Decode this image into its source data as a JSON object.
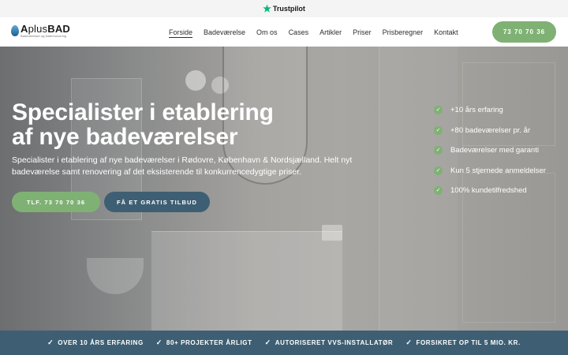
{
  "topbar": {
    "trustpilot_label": "Trustpilot",
    "star_icon": "star-icon"
  },
  "logo": {
    "brand_prefix": "A",
    "brand_mid": "plus",
    "brand_suffix": "BAD",
    "tagline": "Badeværelser og totalrenovering"
  },
  "nav": {
    "items": [
      {
        "label": "Forside",
        "active": true
      },
      {
        "label": "Badeværelse"
      },
      {
        "label": "Om os"
      },
      {
        "label": "Cases"
      },
      {
        "label": "Artikler"
      },
      {
        "label": "Priser"
      },
      {
        "label": "Prisberegner"
      },
      {
        "label": "Kontakt"
      }
    ],
    "phone_button": "73 70 70 36"
  },
  "hero": {
    "title_line1": "Specialister i etablering",
    "title_line2": "af nye badeværelser",
    "subtitle": "Specialister i etablering af nye badeværelser i Rødovre, København & Nordsjælland. Helt nyt badeværelse samt renovering af det eksisterende til konkurrencedygtige priser.",
    "cta_phone": "TLF. 73 70 70 36",
    "cta_offer": "FÅ ET GRATIS TILBUD",
    "features": [
      "+10 års erfaring",
      "+80 badeværelser pr. år",
      "Badeværelser med garanti",
      "Kun 5 stjernede anmeldelser",
      "100% kundetilfredshed"
    ]
  },
  "usps": [
    "OVER 10 ÅRS ERFARING",
    "80+ PROJEKTER ÅRLIGT",
    "AUTORISERET VVS-INSTALLATØR",
    "FORSIKRET OP TIL 5 MIO. KR."
  ],
  "colors": {
    "accent_green": "#7fb174",
    "accent_blue": "#3e5f73",
    "trustpilot_green": "#00b67a"
  }
}
